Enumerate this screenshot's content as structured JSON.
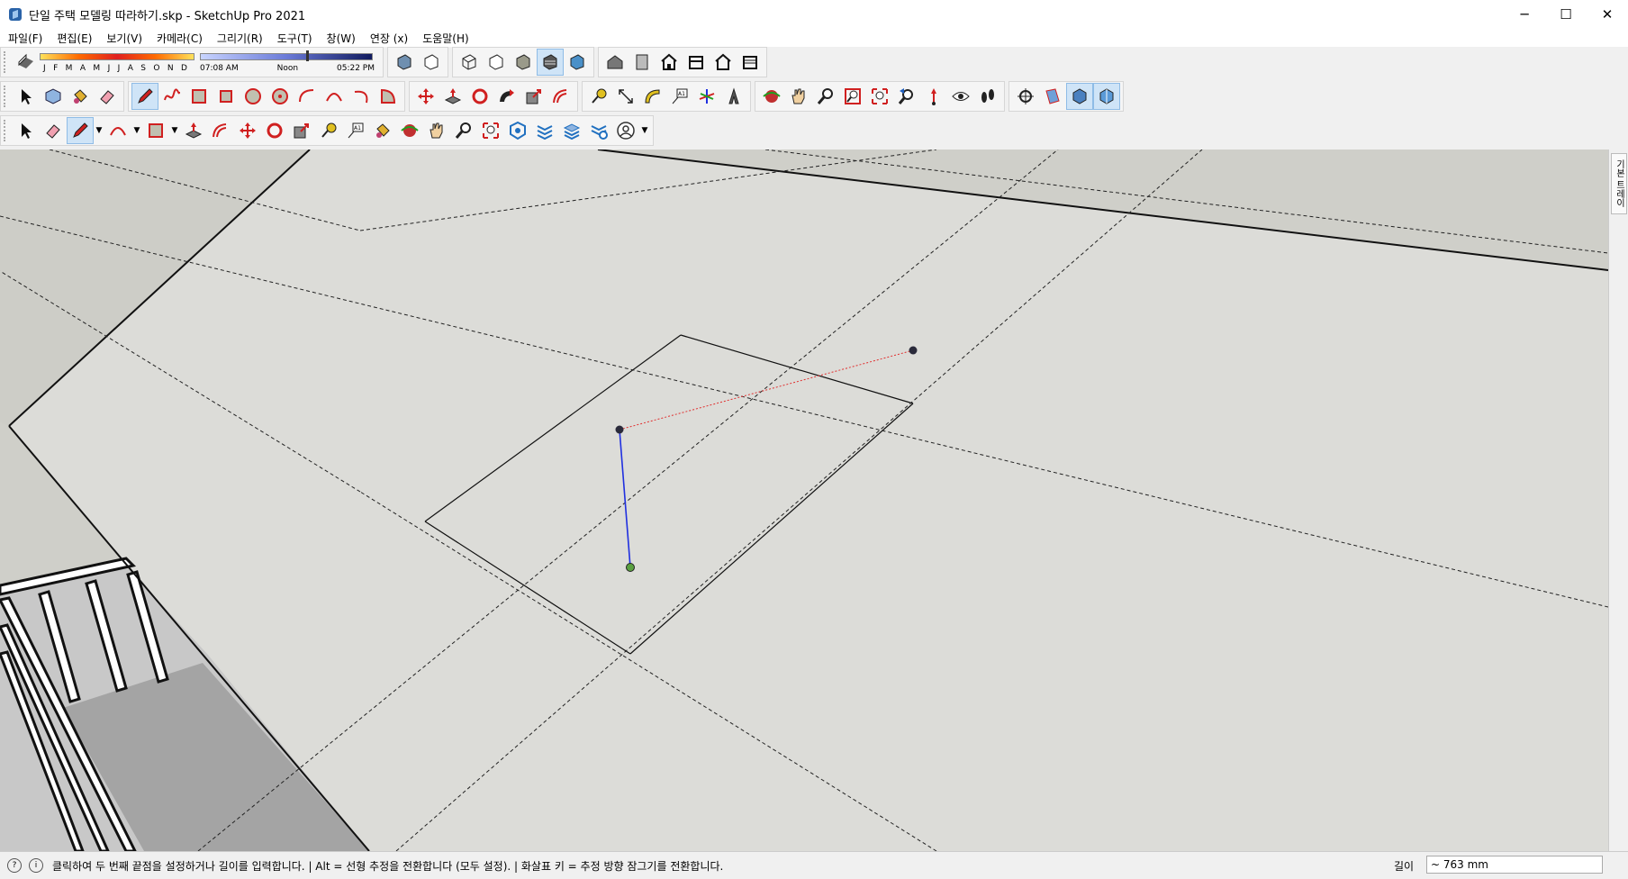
{
  "window": {
    "title": "단일 주택 모델링 따라하기.skp - SketchUp Pro 2021",
    "buttons": [
      "─",
      "☐",
      "✕"
    ]
  },
  "menu": [
    "파일(F)",
    "편집(E)",
    "보기(V)",
    "카메라(C)",
    "그리기(R)",
    "도구(T)",
    "창(W)",
    "연장 (x)",
    "도움말(H)"
  ],
  "shadow": {
    "months": [
      "J",
      "F",
      "M",
      "A",
      "M",
      "J",
      "J",
      "A",
      "S",
      "O",
      "N",
      "D"
    ],
    "time_start": "07:08 AM",
    "time_mid": "Noon",
    "time_end": "05:22 PM"
  },
  "right_panel": {
    "tab_label": "기본 트레이"
  },
  "status": {
    "message": "클릭하여 두 번째 끝점을 설정하거나 길이를 입력합니다. | Alt = 선형 추정을 전환합니다 (모두 설정). | 화살표 키 = 추정 방향 잠그기를 전환합니다.",
    "measure_label": "길이",
    "measure_value": "~ 763 mm"
  },
  "colors": {
    "viewport_ground": "#dadad6",
    "viewport_sky": "#cfcfc9",
    "inference_red": "#e03030",
    "inference_blue": "#2030e0",
    "endpoint_green": "#5aa040"
  },
  "toolbar_icons": {
    "row1": [
      "shadows-icon",
      "face-style-xray-icon",
      "back-edges-icon",
      "wireframe-icon",
      "hidden-line-icon",
      "shaded-icon",
      "shaded-textures-icon",
      "monochrome-icon",
      "iso-view-icon",
      "top-view-icon",
      "front-view-icon",
      "right-view-icon",
      "back-view-icon",
      "left-view-icon"
    ],
    "row2": [
      "select-icon",
      "component-icon",
      "paint-bucket-icon",
      "eraser-icon",
      "pencil-icon",
      "freehand-icon",
      "rectangle-icon",
      "rotated-rectangle-icon",
      "circle-icon",
      "polygon-icon",
      "arc-icon",
      "two-point-arc-icon",
      "three-point-arc-icon",
      "pie-icon",
      "move-icon",
      "push-pull-icon",
      "rotate-icon",
      "follow-me-icon",
      "scale-icon",
      "offset-icon",
      "tape-measure-icon",
      "dimension-icon",
      "protractor-icon",
      "text-icon",
      "axes-icon",
      "3d-text-icon",
      "orbit-icon",
      "pan-icon",
      "zoom-icon",
      "zoom-window-icon",
      "zoom-extents-icon",
      "previous-icon",
      "position-camera-icon",
      "look-around-icon",
      "walk-icon",
      "section-plane-icon",
      "display-section-planes-icon",
      "display-section-cuts-icon",
      "display-section-fill-icon"
    ],
    "row3": [
      "select-icon",
      "eraser-icon",
      "pencil-icon",
      "arc-icon",
      "rectangle-icon",
      "push-pull-icon",
      "follow-me-icon",
      "move-icon",
      "rotate-icon",
      "scale-icon",
      "tape-measure-icon",
      "text-icon",
      "paint-bucket-icon",
      "orbit-icon",
      "pan-icon",
      "zoom-icon",
      "zoom-extents-icon",
      "3d-warehouse-icon",
      "extension-warehouse-icon",
      "layout-icon",
      "extension-manager-icon",
      "user-account-icon"
    ]
  }
}
